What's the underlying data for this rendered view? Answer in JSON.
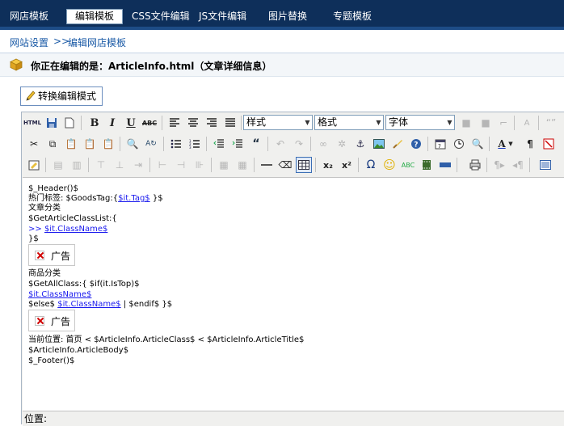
{
  "nav": {
    "tabs": [
      "网店模板",
      "编辑模板",
      "CSS文件编辑",
      "JS文件编辑",
      "图片替换",
      "专题模板"
    ],
    "active": 1
  },
  "breadcrumb": {
    "root": "网站设置",
    "sep": ">>",
    "current": "编辑网店模板"
  },
  "notice": {
    "text": "你正在编辑的是：ArticleInfo.html（文章详细信息）"
  },
  "mode_button": {
    "label": "转换编辑模式"
  },
  "toolbar": {
    "html_label": "HTML",
    "style_select": "样式",
    "format_select": "格式",
    "font_select": "字体"
  },
  "content": {
    "l1": "$_Header()$",
    "l2_a": "热门标签: $GoodsTag:{",
    "l2_link": "$it.Tag$",
    "l2_b": " }$",
    "l3": "文章分类",
    "l4": "$GetArticleClassList:{",
    "l5_a": ">> ",
    "l5_link": "$it.ClassName$",
    "l6": "}$",
    "ad1": "广告",
    "l7": "商品分类",
    "l8": "$GetAllClass:{ $if(it.IsTop)$",
    "l9_link": "$it.ClassName$",
    "l10_a": "$else$ ",
    "l10_link": "$it.ClassName$",
    "l10_b": " | $endif$ }$",
    "ad2": "广告",
    "l11": "当前位置: 首页 < $ArticleInfo.ArticleClass$ < $ArticleInfo.ArticleTitle$",
    "l12": "$ArticleInfo.ArticleBody$",
    "l13": "$_Footer()$"
  },
  "status": {
    "label": "位置:"
  }
}
